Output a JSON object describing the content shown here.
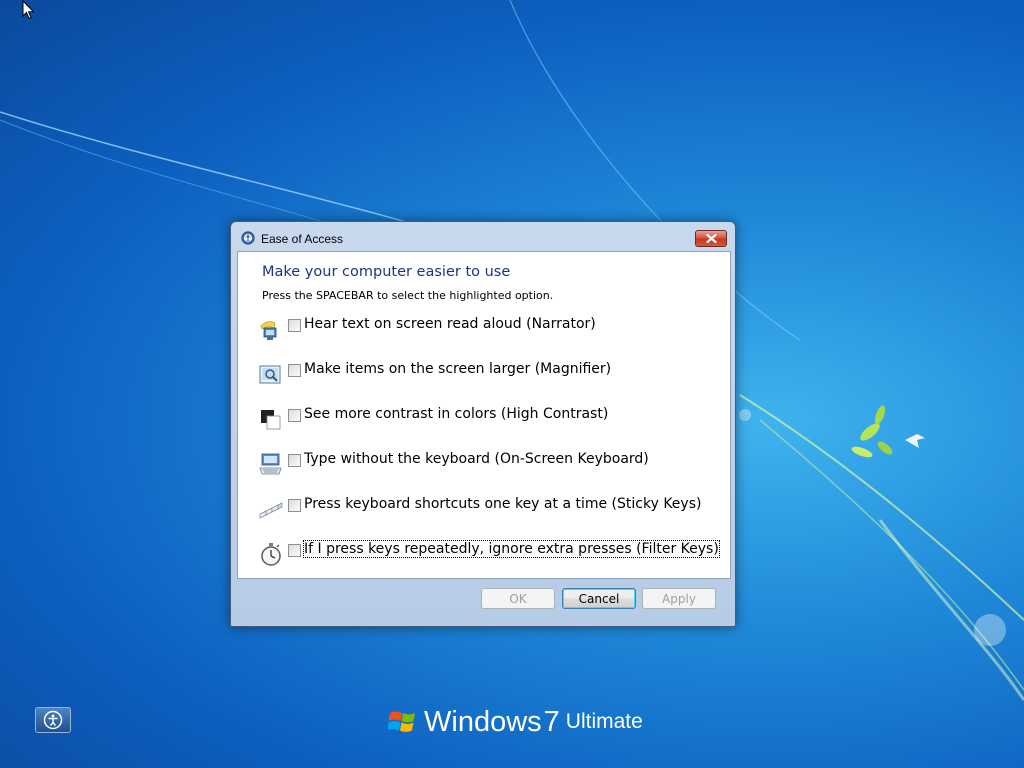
{
  "dialog": {
    "title": "Ease of Access",
    "heading": "Make your computer easier to use",
    "subtitle": "Press the SPACEBAR to select the highlighted option.",
    "options": [
      {
        "label": "Hear text on screen read aloud (Narrator)",
        "icon": "narrator-icon",
        "checked": false
      },
      {
        "label": "Make items on the screen larger (Magnifier)",
        "icon": "magnifier-icon",
        "checked": false
      },
      {
        "label": "See more contrast in colors (High Contrast)",
        "icon": "high-contrast-icon",
        "checked": false
      },
      {
        "label": "Type without the keyboard (On-Screen Keyboard)",
        "icon": "on-screen-keyboard-icon",
        "checked": false
      },
      {
        "label": "Press keyboard shortcuts one key at a time (Sticky Keys)",
        "icon": "sticky-keys-icon",
        "checked": false
      },
      {
        "label": "If I press keys repeatedly, ignore extra presses (Filter Keys)",
        "icon": "filter-keys-icon",
        "checked": false
      }
    ],
    "buttons": {
      "ok": "OK",
      "cancel": "Cancel",
      "apply": "Apply"
    }
  },
  "desktop": {
    "brand_windows": "Windows",
    "brand_version": "7",
    "brand_edition": "Ultimate"
  },
  "colors": {
    "heading": "#1e3287",
    "close_button": "#c23b22",
    "desktop": "#0d5fbf"
  }
}
